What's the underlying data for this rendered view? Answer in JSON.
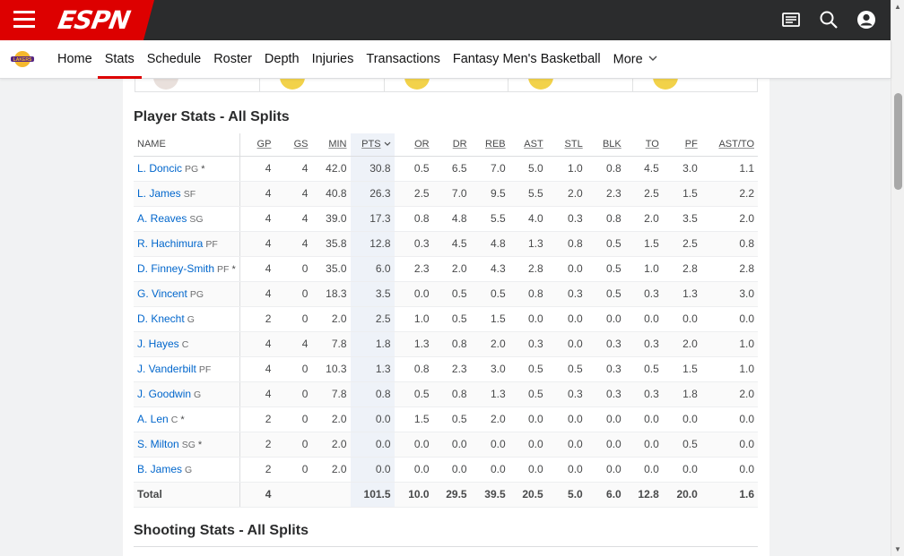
{
  "header": {
    "logo": "ESPN",
    "icons": [
      "news-icon",
      "search-icon",
      "profile-icon"
    ]
  },
  "nav": {
    "items": [
      "Home",
      "Stats",
      "Schedule",
      "Roster",
      "Depth",
      "Injuries",
      "Transactions",
      "Fantasy Men's Basketball",
      "More"
    ],
    "active": "Stats"
  },
  "player_stats": {
    "title": "Player Stats - All Splits",
    "columns": [
      "NAME",
      "GP",
      "GS",
      "MIN",
      "PTS",
      "OR",
      "DR",
      "REB",
      "AST",
      "STL",
      "BLK",
      "TO",
      "PF",
      "AST/TO"
    ],
    "sorted_column": "PTS",
    "rows": [
      {
        "name": "L. Doncic",
        "pos": "PG",
        "star": "*",
        "vals": [
          "4",
          "4",
          "42.0",
          "30.8",
          "0.5",
          "6.5",
          "7.0",
          "5.0",
          "1.0",
          "0.8",
          "4.5",
          "3.0",
          "1.1"
        ]
      },
      {
        "name": "L. James",
        "pos": "SF",
        "star": "",
        "vals": [
          "4",
          "4",
          "40.8",
          "26.3",
          "2.5",
          "7.0",
          "9.5",
          "5.5",
          "2.0",
          "2.3",
          "2.5",
          "1.5",
          "2.2"
        ]
      },
      {
        "name": "A. Reaves",
        "pos": "SG",
        "star": "",
        "vals": [
          "4",
          "4",
          "39.0",
          "17.3",
          "0.8",
          "4.8",
          "5.5",
          "4.0",
          "0.3",
          "0.8",
          "2.0",
          "3.5",
          "2.0"
        ]
      },
      {
        "name": "R. Hachimura",
        "pos": "PF",
        "star": "",
        "vals": [
          "4",
          "4",
          "35.8",
          "12.8",
          "0.3",
          "4.5",
          "4.8",
          "1.3",
          "0.8",
          "0.5",
          "1.5",
          "2.5",
          "0.8"
        ]
      },
      {
        "name": "D. Finney-Smith",
        "pos": "PF",
        "star": "*",
        "vals": [
          "4",
          "0",
          "35.0",
          "6.0",
          "2.3",
          "2.0",
          "4.3",
          "2.8",
          "0.0",
          "0.5",
          "1.0",
          "2.8",
          "2.8"
        ]
      },
      {
        "name": "G. Vincent",
        "pos": "PG",
        "star": "",
        "vals": [
          "4",
          "0",
          "18.3",
          "3.5",
          "0.0",
          "0.5",
          "0.5",
          "0.8",
          "0.3",
          "0.5",
          "0.3",
          "1.3",
          "3.0"
        ]
      },
      {
        "name": "D. Knecht",
        "pos": "G",
        "star": "",
        "vals": [
          "2",
          "0",
          "2.0",
          "2.5",
          "1.0",
          "0.5",
          "1.5",
          "0.0",
          "0.0",
          "0.0",
          "0.0",
          "0.0",
          "0.0"
        ]
      },
      {
        "name": "J. Hayes",
        "pos": "C",
        "star": "",
        "vals": [
          "4",
          "4",
          "7.8",
          "1.8",
          "1.3",
          "0.8",
          "2.0",
          "0.3",
          "0.0",
          "0.3",
          "0.3",
          "2.0",
          "1.0"
        ]
      },
      {
        "name": "J. Vanderbilt",
        "pos": "PF",
        "star": "",
        "vals": [
          "4",
          "0",
          "10.3",
          "1.3",
          "0.8",
          "2.3",
          "3.0",
          "0.5",
          "0.5",
          "0.3",
          "0.5",
          "1.5",
          "1.0"
        ]
      },
      {
        "name": "J. Goodwin",
        "pos": "G",
        "star": "",
        "vals": [
          "4",
          "0",
          "7.8",
          "0.8",
          "0.5",
          "0.8",
          "1.3",
          "0.5",
          "0.3",
          "0.3",
          "0.3",
          "1.8",
          "2.0"
        ]
      },
      {
        "name": "A. Len",
        "pos": "C",
        "star": "*",
        "vals": [
          "2",
          "0",
          "2.0",
          "0.0",
          "1.5",
          "0.5",
          "2.0",
          "0.0",
          "0.0",
          "0.0",
          "0.0",
          "0.0",
          "0.0"
        ]
      },
      {
        "name": "S. Milton",
        "pos": "SG",
        "star": "*",
        "vals": [
          "2",
          "0",
          "2.0",
          "0.0",
          "0.0",
          "0.0",
          "0.0",
          "0.0",
          "0.0",
          "0.0",
          "0.0",
          "0.5",
          "0.0"
        ]
      },
      {
        "name": "B. James",
        "pos": "G",
        "star": "",
        "vals": [
          "2",
          "0",
          "2.0",
          "0.0",
          "0.0",
          "0.0",
          "0.0",
          "0.0",
          "0.0",
          "0.0",
          "0.0",
          "0.0",
          "0.0"
        ]
      }
    ],
    "total": {
      "label": "Total",
      "vals": [
        "4",
        "",
        "",
        "101.5",
        "10.0",
        "29.5",
        "39.5",
        "20.5",
        "5.0",
        "6.0",
        "12.8",
        "20.0",
        "1.6"
      ]
    }
  },
  "shooting_stats": {
    "title": "Shooting Stats - All Splits"
  }
}
